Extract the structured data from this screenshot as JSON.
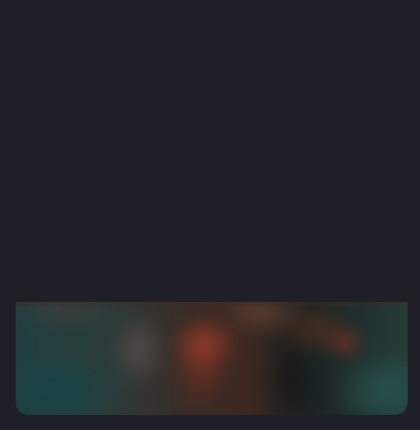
{
  "theme": {
    "background": "#1f1f28"
  },
  "media": {
    "content": "blurred-image",
    "dominant_colors": [
      "#1d3f40",
      "#96402a",
      "#5f524e",
      "#121816"
    ]
  }
}
